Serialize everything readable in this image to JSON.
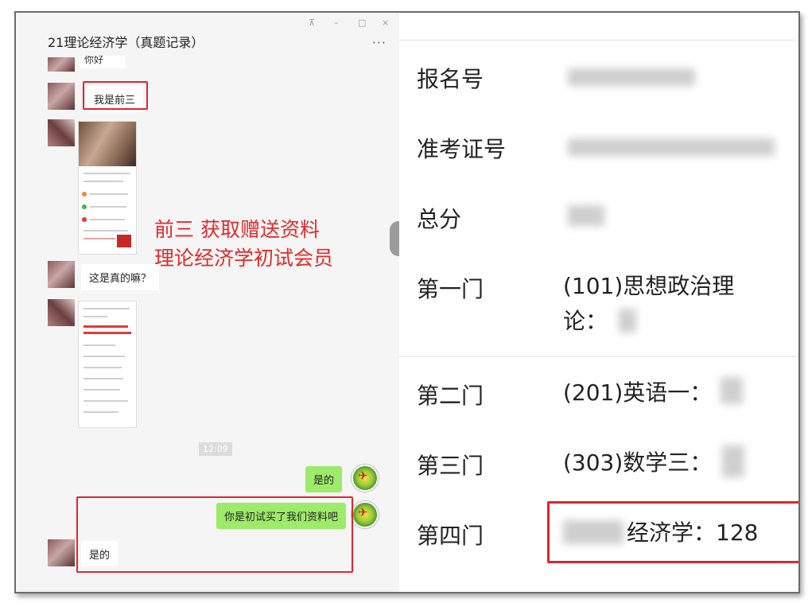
{
  "chat": {
    "title": "21理论经济学（真题记录）",
    "window_controls": {
      "pin": "⊼",
      "minimize": "–",
      "maximize": "□",
      "close": "×"
    },
    "more": "···",
    "messages": {
      "partial_top": "你好",
      "m1": "我是前三",
      "m2": "这是真的嘛？",
      "time": "12:09",
      "m3": "是的",
      "m4": "你是初试买了我们资料吧",
      "m5": "是的"
    },
    "overlay_line1": "前三 获取赠送资料",
    "overlay_line2": "理论经济学初试会员"
  },
  "score": {
    "rows": [
      {
        "label": "报名号",
        "value": ""
      },
      {
        "label": "准考证号",
        "value": ""
      },
      {
        "label": "总分",
        "value": ""
      },
      {
        "label": "第一门",
        "value": "(101)思想政治理论："
      },
      {
        "label": "第二门",
        "value": "(201)英语一："
      },
      {
        "label": "第三门",
        "value": "(303)数学三："
      },
      {
        "label": "第四门",
        "value": "经济学：128"
      }
    ]
  },
  "colors": {
    "highlight": "#e0262b",
    "bubble_self": "#9eea6a",
    "overlay_text": "#e32a2a"
  }
}
